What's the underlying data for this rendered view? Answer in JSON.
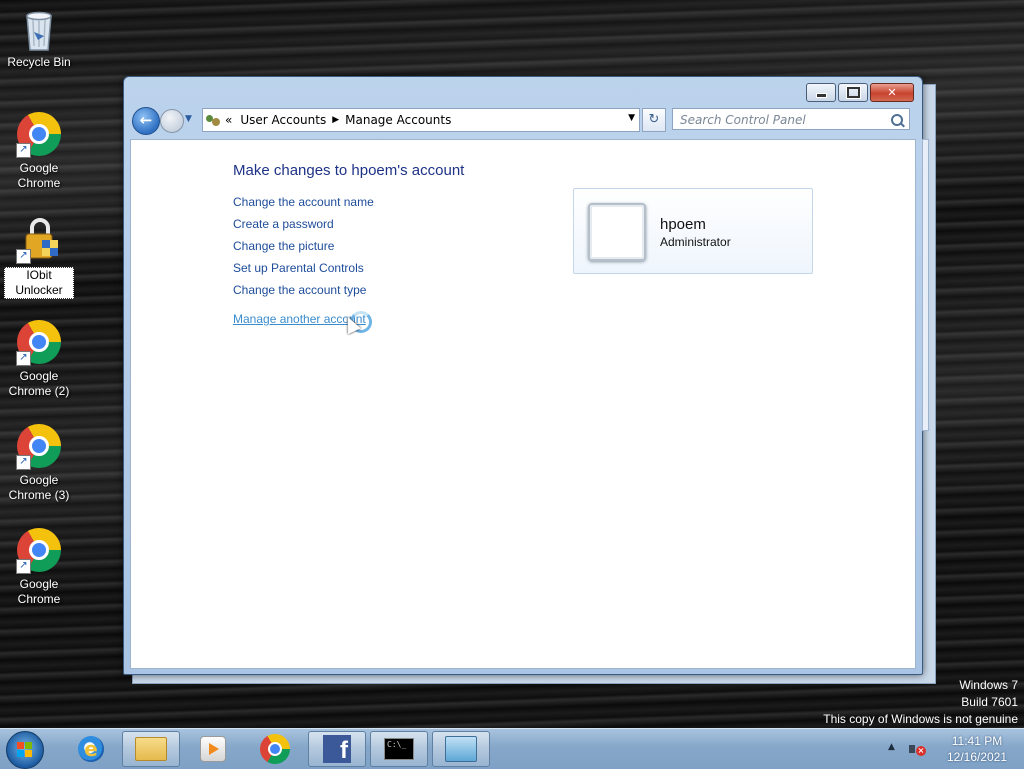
{
  "desktop": {
    "icons": [
      {
        "label": "Recycle Bin",
        "icon": "recycle-bin-icon"
      },
      {
        "label": "Google Chrome",
        "icon": "chrome-icon"
      },
      {
        "label": "IObit Unlocker",
        "icon": "iobit-unlocker-icon"
      },
      {
        "label": "Google Chrome (2)",
        "icon": "chrome-icon"
      },
      {
        "label": "Google Chrome (3)",
        "icon": "chrome-icon"
      },
      {
        "label": "Google Chrome",
        "icon": "chrome-icon"
      }
    ]
  },
  "window": {
    "breadcrumb": {
      "overflow": "«",
      "items": [
        "User Accounts",
        "Manage Accounts"
      ]
    },
    "search_placeholder": "Search Control Panel",
    "heading": "Make changes to hpoem's account",
    "links": [
      "Change the account name",
      "Create a password",
      "Change the picture",
      "Set up Parental Controls",
      "Change the account type"
    ],
    "other_link": "Manage another account",
    "account": {
      "name": "hpoem",
      "role": "Administrator"
    }
  },
  "watermark": {
    "line1": "Windows 7",
    "line2": "Build 7601",
    "line3": "This copy of Windows is not genuine"
  },
  "taskbar": {
    "pinned": [
      "internet-explorer-icon",
      "windows-explorer-icon",
      "media-player-icon",
      "chrome-icon",
      "facebook-icon",
      "command-prompt-icon",
      "control-panel-icon"
    ],
    "clock": {
      "time": "11:41 PM",
      "date": "12/16/2021"
    }
  },
  "colors": {
    "link": "#1e4c9a",
    "heading": "#1e3287",
    "taskbar": "#86a7c9"
  }
}
